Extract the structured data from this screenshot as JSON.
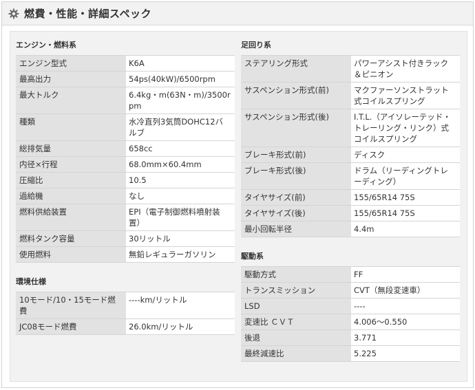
{
  "header": {
    "title": "燃費・性能・詳細スペック",
    "icon": "gear-icon",
    "background": "#f2f2f2"
  },
  "sections": {
    "engine": {
      "title": "エンジン・燃料系",
      "rows": [
        {
          "label": "エンジン型式",
          "value": "K6A"
        },
        {
          "label": "最高出力",
          "value": "54ps(40kW)/6500rpm"
        },
        {
          "label": "最大トルク",
          "value": "6.4kg・m(63N・m)/3500rpm"
        },
        {
          "label": "種類",
          "value": "水冷直列3気筒DOHC12バルブ"
        },
        {
          "label": "総排気量",
          "value": "658cc"
        },
        {
          "label": "内径×行程",
          "value": "68.0mm×60.4mm"
        },
        {
          "label": "圧縮比",
          "value": "10.5"
        },
        {
          "label": "過給機",
          "value": "なし"
        },
        {
          "label": "燃料供給装置",
          "value": "EPI（電子制御燃料噴射装置）"
        },
        {
          "label": "燃料タンク容量",
          "value": "30リットル"
        },
        {
          "label": "使用燃料",
          "value": "無鉛レギュラーガソリン"
        }
      ]
    },
    "environment": {
      "title": "環境仕様",
      "rows": [
        {
          "label": "10モード/10・15モード燃費",
          "value": "----km/リットル"
        },
        {
          "label": "JC08モード燃費",
          "value": "26.0km/リットル"
        }
      ]
    },
    "suspension": {
      "title": "足回り系",
      "rows": [
        {
          "label": "ステアリング形式",
          "value": "パワーアシスト付きラック＆ピニオン"
        },
        {
          "label": "サスペンション形式(前)",
          "value": "マクファーソンストラット式コイルスプリング"
        },
        {
          "label": "サスペンション形式(後)",
          "value": "I.T.L.（アイソレーテッド・トレーリング・リンク）式コイルスプリング"
        },
        {
          "label": "ブレーキ形式(前)",
          "value": "ディスク"
        },
        {
          "label": "ブレーキ形式(後)",
          "value": "ドラム（リーディングトレーディング）"
        },
        {
          "label": "タイヤサイズ(前)",
          "value": "155/65R14 75S"
        },
        {
          "label": "タイヤサイズ(後)",
          "value": "155/65R14 75S"
        },
        {
          "label": "最小回転半径",
          "value": "4.4m"
        }
      ]
    },
    "drivetrain": {
      "title": "駆動系",
      "rows": [
        {
          "label": "駆動方式",
          "value": "FF"
        },
        {
          "label": "トランスミッション",
          "value": "CVT（無段変速車）"
        },
        {
          "label": "LSD",
          "value": "----"
        },
        {
          "label": "変速比 ＣＶＴ",
          "value": "4.006～0.550"
        },
        {
          "label": "後退",
          "value": "3.771"
        },
        {
          "label": "最終減速比",
          "value": "5.225"
        }
      ]
    }
  }
}
